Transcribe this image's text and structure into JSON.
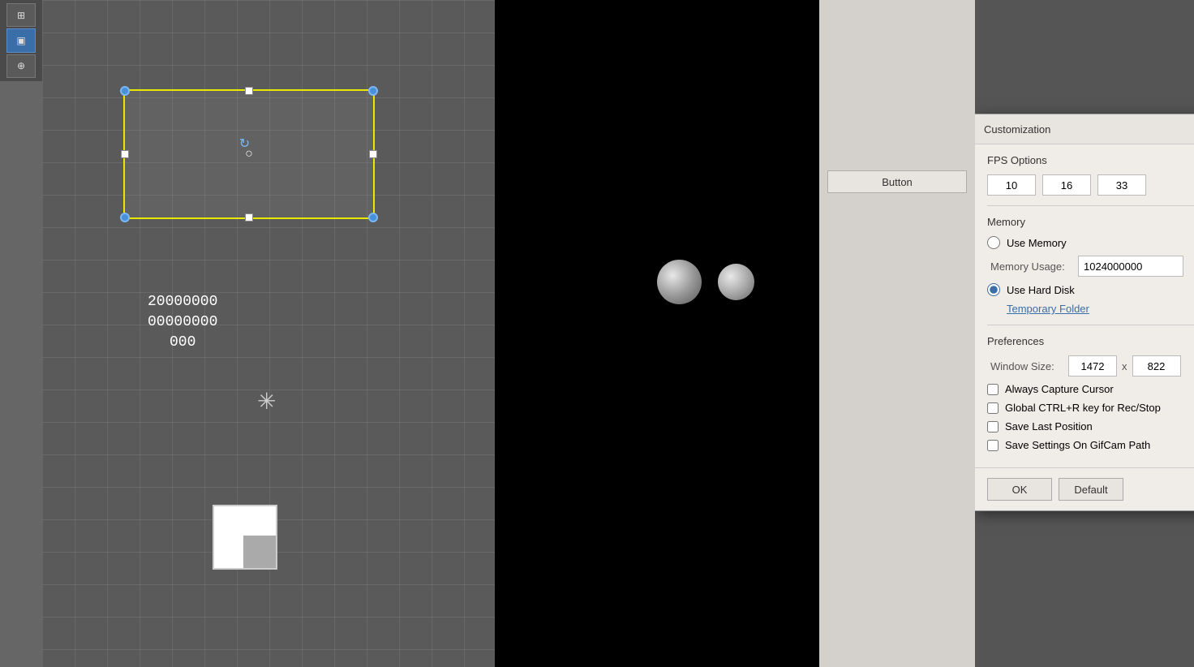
{
  "toolbar": {
    "buttons": [
      {
        "label": "⊞",
        "active": false,
        "name": "grid-button"
      },
      {
        "label": "▣",
        "active": true,
        "name": "select-button"
      },
      {
        "label": "⊕",
        "active": false,
        "name": "transform-button"
      }
    ]
  },
  "canvas": {
    "numbers_line1": "20000000",
    "numbers_line2": "00000000",
    "numbers_line3": "000"
  },
  "right_panel": {
    "button_label": "Button"
  },
  "dialog": {
    "title": "Customization",
    "close_label": "✕",
    "fps_section_label": "FPS Options",
    "fps_values": [
      "10",
      "16",
      "33"
    ],
    "memory_section_label": "Memory",
    "use_memory_label": "Use Memory",
    "use_memory_checked": false,
    "memory_usage_label": "Memory Usage:",
    "memory_usage_value": "1024000000",
    "use_hard_disk_label": "Use Hard Disk",
    "use_hard_disk_checked": true,
    "temporary_folder_label": "Temporary Folder",
    "preferences_section_label": "Preferences",
    "window_size_label": "Window Size:",
    "window_width": "1472",
    "window_x_separator": "x",
    "window_height": "822",
    "always_capture_cursor_label": "Always Capture Cursor",
    "always_capture_cursor_checked": false,
    "global_ctrl_r_label": "Global CTRL+R key for Rec/Stop",
    "global_ctrl_r_checked": false,
    "save_last_position_label": "Save Last Position",
    "save_last_position_checked": false,
    "save_settings_label": "Save Settings On GifCam Path",
    "save_settings_checked": false,
    "ok_label": "OK",
    "default_label": "Default"
  }
}
